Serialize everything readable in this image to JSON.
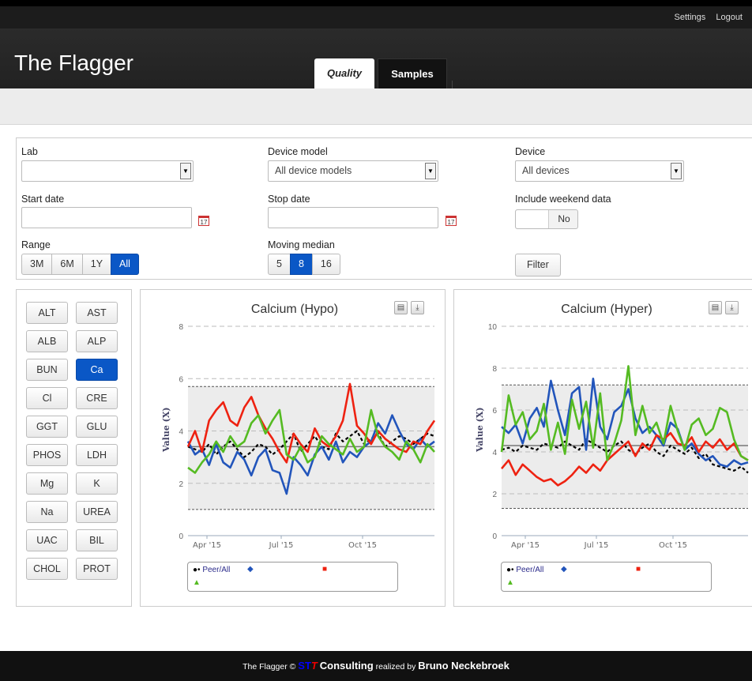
{
  "topbar": {
    "settings": "Settings",
    "logout": "Logout"
  },
  "app": {
    "title": "The Flagger"
  },
  "tabs": [
    {
      "label": "Quality",
      "active": true
    },
    {
      "label": "Samples",
      "active": false
    }
  ],
  "filters": {
    "lab": {
      "label": "Lab",
      "value": ""
    },
    "device_model": {
      "label": "Device model",
      "value": "All device models"
    },
    "device": {
      "label": "Device",
      "value": "All devices"
    },
    "start_date": {
      "label": "Start date",
      "value": ""
    },
    "stop_date": {
      "label": "Stop date",
      "value": ""
    },
    "weekend": {
      "label": "Include weekend data",
      "value": "No"
    },
    "range": {
      "label": "Range",
      "options": [
        "3M",
        "6M",
        "1Y",
        "All"
      ],
      "selected": "All"
    },
    "moving_median": {
      "label": "Moving median",
      "options": [
        "5",
        "8",
        "16"
      ],
      "selected": "8"
    },
    "filter_button": "Filter",
    "calendar_glyph": "17"
  },
  "analytes": {
    "selected": "Ca",
    "items": [
      "ALT",
      "AST",
      "ALB",
      "ALP",
      "BUN",
      "Ca",
      "Cl",
      "CRE",
      "GGT",
      "GLU",
      "PHOS",
      "LDH",
      "Mg",
      "K",
      "Na",
      "UREA",
      "UAC",
      "BIL",
      "CHOL",
      "PROT"
    ]
  },
  "colors": {
    "accent": "#0a57c6",
    "peer": "#000000",
    "s1": "#2255bb",
    "s2": "#ee2211",
    "s3": "#55bb22",
    "band": "#ececec"
  },
  "chart_data": [
    {
      "type": "line",
      "title": "Calcium (Hypo)",
      "ylabel": "Value (X)",
      "ylim": [
        0,
        8
      ],
      "yticks": [
        0,
        2,
        4,
        6,
        8
      ],
      "xticks": [
        "Apr '15",
        "Jul '15",
        "Oct '15"
      ],
      "x": [
        0,
        1,
        2,
        3,
        4,
        5,
        6,
        7,
        8,
        9,
        10,
        11,
        12,
        13,
        14,
        15,
        16,
        17,
        18,
        19,
        20,
        21,
        22,
        23,
        24,
        25,
        26,
        27,
        28,
        29,
        30,
        31,
        32,
        33,
        34,
        35
      ],
      "limits": {
        "upper": 5.7,
        "lower": 1.0,
        "center": 3.4
      },
      "legend": [
        "Peer/All",
        "",
        "",
        ""
      ],
      "series": [
        {
          "name": "Peer/All",
          "style": "dash",
          "color": "#000000",
          "values": [
            3.4,
            3.3,
            3.2,
            3.5,
            3.1,
            3.4,
            3.6,
            3.3,
            3.0,
            3.2,
            3.5,
            3.4,
            3.1,
            3.3,
            3.6,
            3.9,
            3.2,
            3.5,
            3.8,
            3.4,
            3.3,
            3.9,
            3.6,
            3.8,
            4.0,
            3.5,
            3.7,
            3.9,
            3.4,
            3.6,
            3.8,
            3.7,
            3.5,
            3.7,
            3.9,
            3.8
          ]
        },
        {
          "name": "",
          "color": "#2255bb",
          "values": [
            3.6,
            3.1,
            3.3,
            2.7,
            3.5,
            2.8,
            2.6,
            3.2,
            2.9,
            2.3,
            3.0,
            3.3,
            2.5,
            2.4,
            1.6,
            3.0,
            2.7,
            2.3,
            3.1,
            3.4,
            2.9,
            3.6,
            2.8,
            3.2,
            3.0,
            3.4,
            3.6,
            4.3,
            3.9,
            4.6,
            4.0,
            3.5,
            3.3,
            3.7,
            3.4,
            3.6
          ]
        },
        {
          "name": "",
          "color": "#ee2211",
          "values": [
            3.4,
            4.0,
            3.2,
            4.4,
            4.8,
            5.1,
            4.4,
            4.2,
            4.9,
            5.3,
            4.6,
            4.1,
            3.7,
            3.2,
            2.8,
            3.9,
            3.5,
            3.2,
            4.1,
            3.6,
            3.4,
            3.8,
            4.4,
            5.8,
            4.2,
            3.9,
            3.5,
            4.0,
            3.7,
            3.5,
            3.3,
            3.2,
            3.6,
            3.5,
            4.0,
            4.4
          ]
        },
        {
          "name": "",
          "color": "#55bb22",
          "values": [
            2.6,
            2.4,
            2.8,
            3.1,
            3.6,
            3.2,
            3.8,
            3.4,
            3.6,
            4.3,
            4.6,
            3.9,
            4.4,
            4.8,
            3.1,
            2.9,
            3.4,
            2.8,
            3.0,
            3.8,
            3.5,
            3.3,
            3.1,
            3.7,
            3.2,
            3.4,
            4.8,
            3.8,
            3.4,
            3.2,
            2.9,
            3.6,
            3.3,
            2.8,
            3.5,
            3.2
          ]
        }
      ]
    },
    {
      "type": "line",
      "title": "Calcium (Hyper)",
      "ylabel": "Value (X)",
      "ylim": [
        0,
        10
      ],
      "yticks": [
        0,
        2,
        4,
        6,
        8,
        10
      ],
      "xticks": [
        "Apr '15",
        "Jul '15",
        "Oct '15"
      ],
      "x": [
        0,
        1,
        2,
        3,
        4,
        5,
        6,
        7,
        8,
        9,
        10,
        11,
        12,
        13,
        14,
        15,
        16,
        17,
        18,
        19,
        20,
        21,
        22,
        23,
        24,
        25,
        26,
        27,
        28,
        29,
        30,
        31,
        32,
        33,
        34,
        35
      ],
      "limits": {
        "upper": 7.2,
        "lower": 1.3,
        "center": 4.3
      },
      "legend": [
        "Peer/All",
        "",
        "",
        ""
      ],
      "series": [
        {
          "name": "Peer/All",
          "style": "dash",
          "color": "#000000",
          "values": [
            4.1,
            4.2,
            4.0,
            4.3,
            4.2,
            4.1,
            4.4,
            4.3,
            4.2,
            4.5,
            4.3,
            4.1,
            4.6,
            4.4,
            4.2,
            4.0,
            4.3,
            4.5,
            4.1,
            3.9,
            4.2,
            4.4,
            4.0,
            3.8,
            4.3,
            4.1,
            3.9,
            4.2,
            3.7,
            3.9,
            3.4,
            3.3,
            3.2,
            3.1,
            3.3,
            3.0
          ]
        },
        {
          "name": "",
          "color": "#2255bb",
          "values": [
            5.2,
            4.9,
            5.3,
            4.4,
            5.6,
            6.1,
            5.2,
            7.4,
            6.0,
            4.8,
            6.8,
            7.1,
            4.1,
            7.5,
            5.2,
            4.6,
            5.9,
            6.2,
            7.0,
            5.6,
            4.9,
            5.2,
            4.8,
            4.3,
            5.4,
            5.1,
            4.1,
            4.4,
            3.9,
            3.6,
            3.8,
            3.4,
            3.3,
            3.6,
            3.4,
            3.5
          ]
        },
        {
          "name": "",
          "color": "#ee2211",
          "values": [
            3.2,
            3.6,
            2.9,
            3.4,
            3.1,
            2.8,
            2.6,
            2.7,
            2.4,
            2.6,
            2.9,
            3.3,
            3.0,
            3.4,
            3.1,
            3.6,
            3.9,
            4.2,
            4.5,
            3.8,
            4.4,
            4.1,
            4.8,
            4.6,
            4.9,
            4.4,
            4.3,
            4.7,
            4.0,
            4.5,
            4.2,
            4.6,
            4.1,
            4.4,
            3.8,
            3.6
          ]
        },
        {
          "name": "",
          "color": "#55bb22",
          "values": [
            4.0,
            6.7,
            5.3,
            5.9,
            4.6,
            5.0,
            6.3,
            4.1,
            5.4,
            3.9,
            6.5,
            5.1,
            6.4,
            4.2,
            6.8,
            3.6,
            4.4,
            5.5,
            8.1,
            4.8,
            6.2,
            4.9,
            5.4,
            4.4,
            6.2,
            5.0,
            4.1,
            5.3,
            5.6,
            4.8,
            5.1,
            6.1,
            5.9,
            4.6,
            3.8,
            3.6
          ]
        }
      ]
    }
  ],
  "footer": {
    "prefix": "The Flagger ©",
    "stt_s": "ST",
    "stt_t": "T",
    "consulting": "Consulting",
    "realized": "realized by",
    "author": "Bruno Neckebroek"
  }
}
